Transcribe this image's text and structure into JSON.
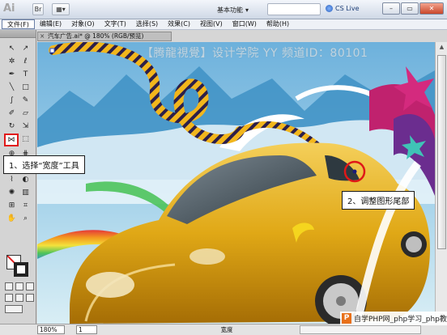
{
  "app": {
    "logo": "Ai",
    "workspace": "基本功能",
    "cs_live": "CS Live"
  },
  "menu": [
    "文件(F)",
    "编辑(E)",
    "对象(O)",
    "文字(T)",
    "选择(S)",
    "效果(C)",
    "视图(V)",
    "窗口(W)",
    "帮助(H)"
  ],
  "document": {
    "tab_title": "汽车广告.ai* @ 180% (RGB/预览)"
  },
  "canvas": {
    "watermark": "【腾龍視覺】设计学院  YY 频道ID：80101"
  },
  "callouts": {
    "step1": "1、选择“宽度”工具",
    "step2": "2、调整图形尾部"
  },
  "status": {
    "zoom": "180%",
    "page": "1",
    "tool_name": "宽度"
  },
  "footer_watermark": "自学PHP网_php学习_php教"
}
